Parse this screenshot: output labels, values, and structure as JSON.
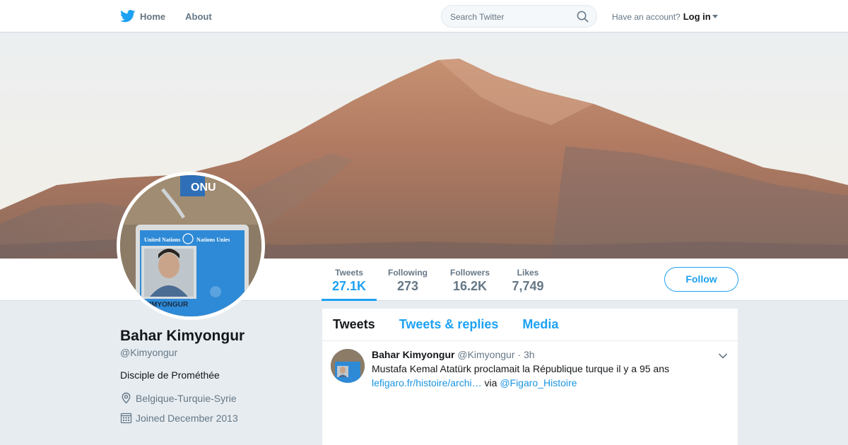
{
  "nav": {
    "home_label": "Home",
    "about_label": "About",
    "search_placeholder": "Search Twitter",
    "account_prompt": "Have an account?",
    "login_label": "Log in"
  },
  "colors": {
    "accent": "#1da1f2",
    "link": "#1b95e0",
    "muted": "#657786",
    "page_bg": "#e6ecf0"
  },
  "profile": {
    "name": "Bahar Kimyongur",
    "handle": "@Kimyongur",
    "bio": "Disciple de Prométhée",
    "location": "Belgique-Turquie-Syrie",
    "joined": "Joined December 2013"
  },
  "stats": [
    {
      "label": "Tweets",
      "value": "27.1K",
      "active": true
    },
    {
      "label": "Following",
      "value": "273",
      "active": false
    },
    {
      "label": "Followers",
      "value": "16.2K",
      "active": false
    },
    {
      "label": "Likes",
      "value": "7,749",
      "active": false
    }
  ],
  "follow_label": "Follow",
  "timeline": {
    "tabs": [
      "Tweets",
      "Tweets & replies",
      "Media"
    ],
    "tweet": {
      "name": "Bahar Kimyongur",
      "handle": "@Kimyongur",
      "dot": "·",
      "time": "3h",
      "text": "Mustafa Kemal Atatürk proclamait la République turque il y a 95 ans",
      "link": "lefigaro.fr/histoire/archi…",
      "via": "via",
      "mention": "@Figaro_Histoire"
    }
  },
  "icons": {
    "logo": "twitter-bird-icon",
    "search": "search-icon",
    "location": "location-pin-icon",
    "calendar": "calendar-icon",
    "chevron": "chevron-down-icon"
  },
  "avatar_badge": {
    "org": "United Nations",
    "org_fr": "Nations Unies",
    "lanyard": "ONU",
    "name": "KIMYONGUR"
  }
}
